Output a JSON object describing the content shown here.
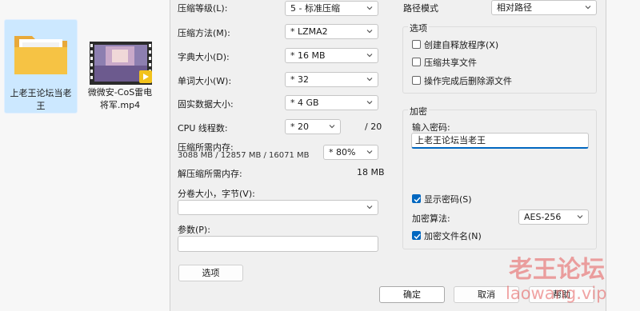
{
  "explorer": {
    "files": [
      {
        "name": "上老王论坛当老王",
        "icon": "folder-icon"
      },
      {
        "name": "微微安-CoS雷电将军.mp4",
        "icon": "video-thumbnail-icon"
      }
    ]
  },
  "left": {
    "compression_level": {
      "label": "压缩等级(L):",
      "value": "5 - 标准压缩"
    },
    "compression_method": {
      "label": "压缩方法(M):",
      "value": "* LZMA2"
    },
    "dictionary_size": {
      "label": "字典大小(D):",
      "value": "* 16 MB"
    },
    "word_size": {
      "label": "单词大小(W):",
      "value": "* 32"
    },
    "solid_block_size": {
      "label": "固实数据大小:",
      "value": "* 4 GB"
    },
    "cpu_threads": {
      "label": "CPU 线程数:",
      "value": "* 20",
      "total": "/ 20"
    },
    "memory_compress": {
      "label": "压缩所需内存:",
      "detail": "3088 MB / 12857 MB / 16071 MB",
      "value": "* 80%"
    },
    "memory_decompress": {
      "label": "解压缩所需内存:",
      "value": "18 MB"
    },
    "split_volume": {
      "label": "分卷大小，字节(V):",
      "value": ""
    },
    "parameters": {
      "label": "参数(P):",
      "value": ""
    },
    "options_button": "选项"
  },
  "right": {
    "path_mode": {
      "label": "路径模式",
      "value": "相对路径"
    },
    "options_group": {
      "title": "选项",
      "items": [
        {
          "label": "创建自释放程序(X)",
          "checked": false
        },
        {
          "label": "压缩共享文件",
          "checked": false
        },
        {
          "label": "操作完成后删除源文件",
          "checked": false
        }
      ]
    },
    "encryption": {
      "title": "加密",
      "password_label": "输入密码:",
      "password_value": "上老王论坛当老王",
      "show_password": {
        "label": "显示密码(S)",
        "checked": true
      },
      "method_label": "加密算法:",
      "method_value": "AES-256",
      "encrypt_names": {
        "label": "加密文件名(N)",
        "checked": true
      }
    }
  },
  "buttons": {
    "ok": "确定",
    "cancel": "取消",
    "help": "帮助"
  },
  "watermark": {
    "line1": "老王论坛",
    "line2": "laowang.vip"
  },
  "colors": {
    "accent": "#0067c0",
    "selection": "#cce8ff",
    "watermark": "#e55a5a"
  }
}
